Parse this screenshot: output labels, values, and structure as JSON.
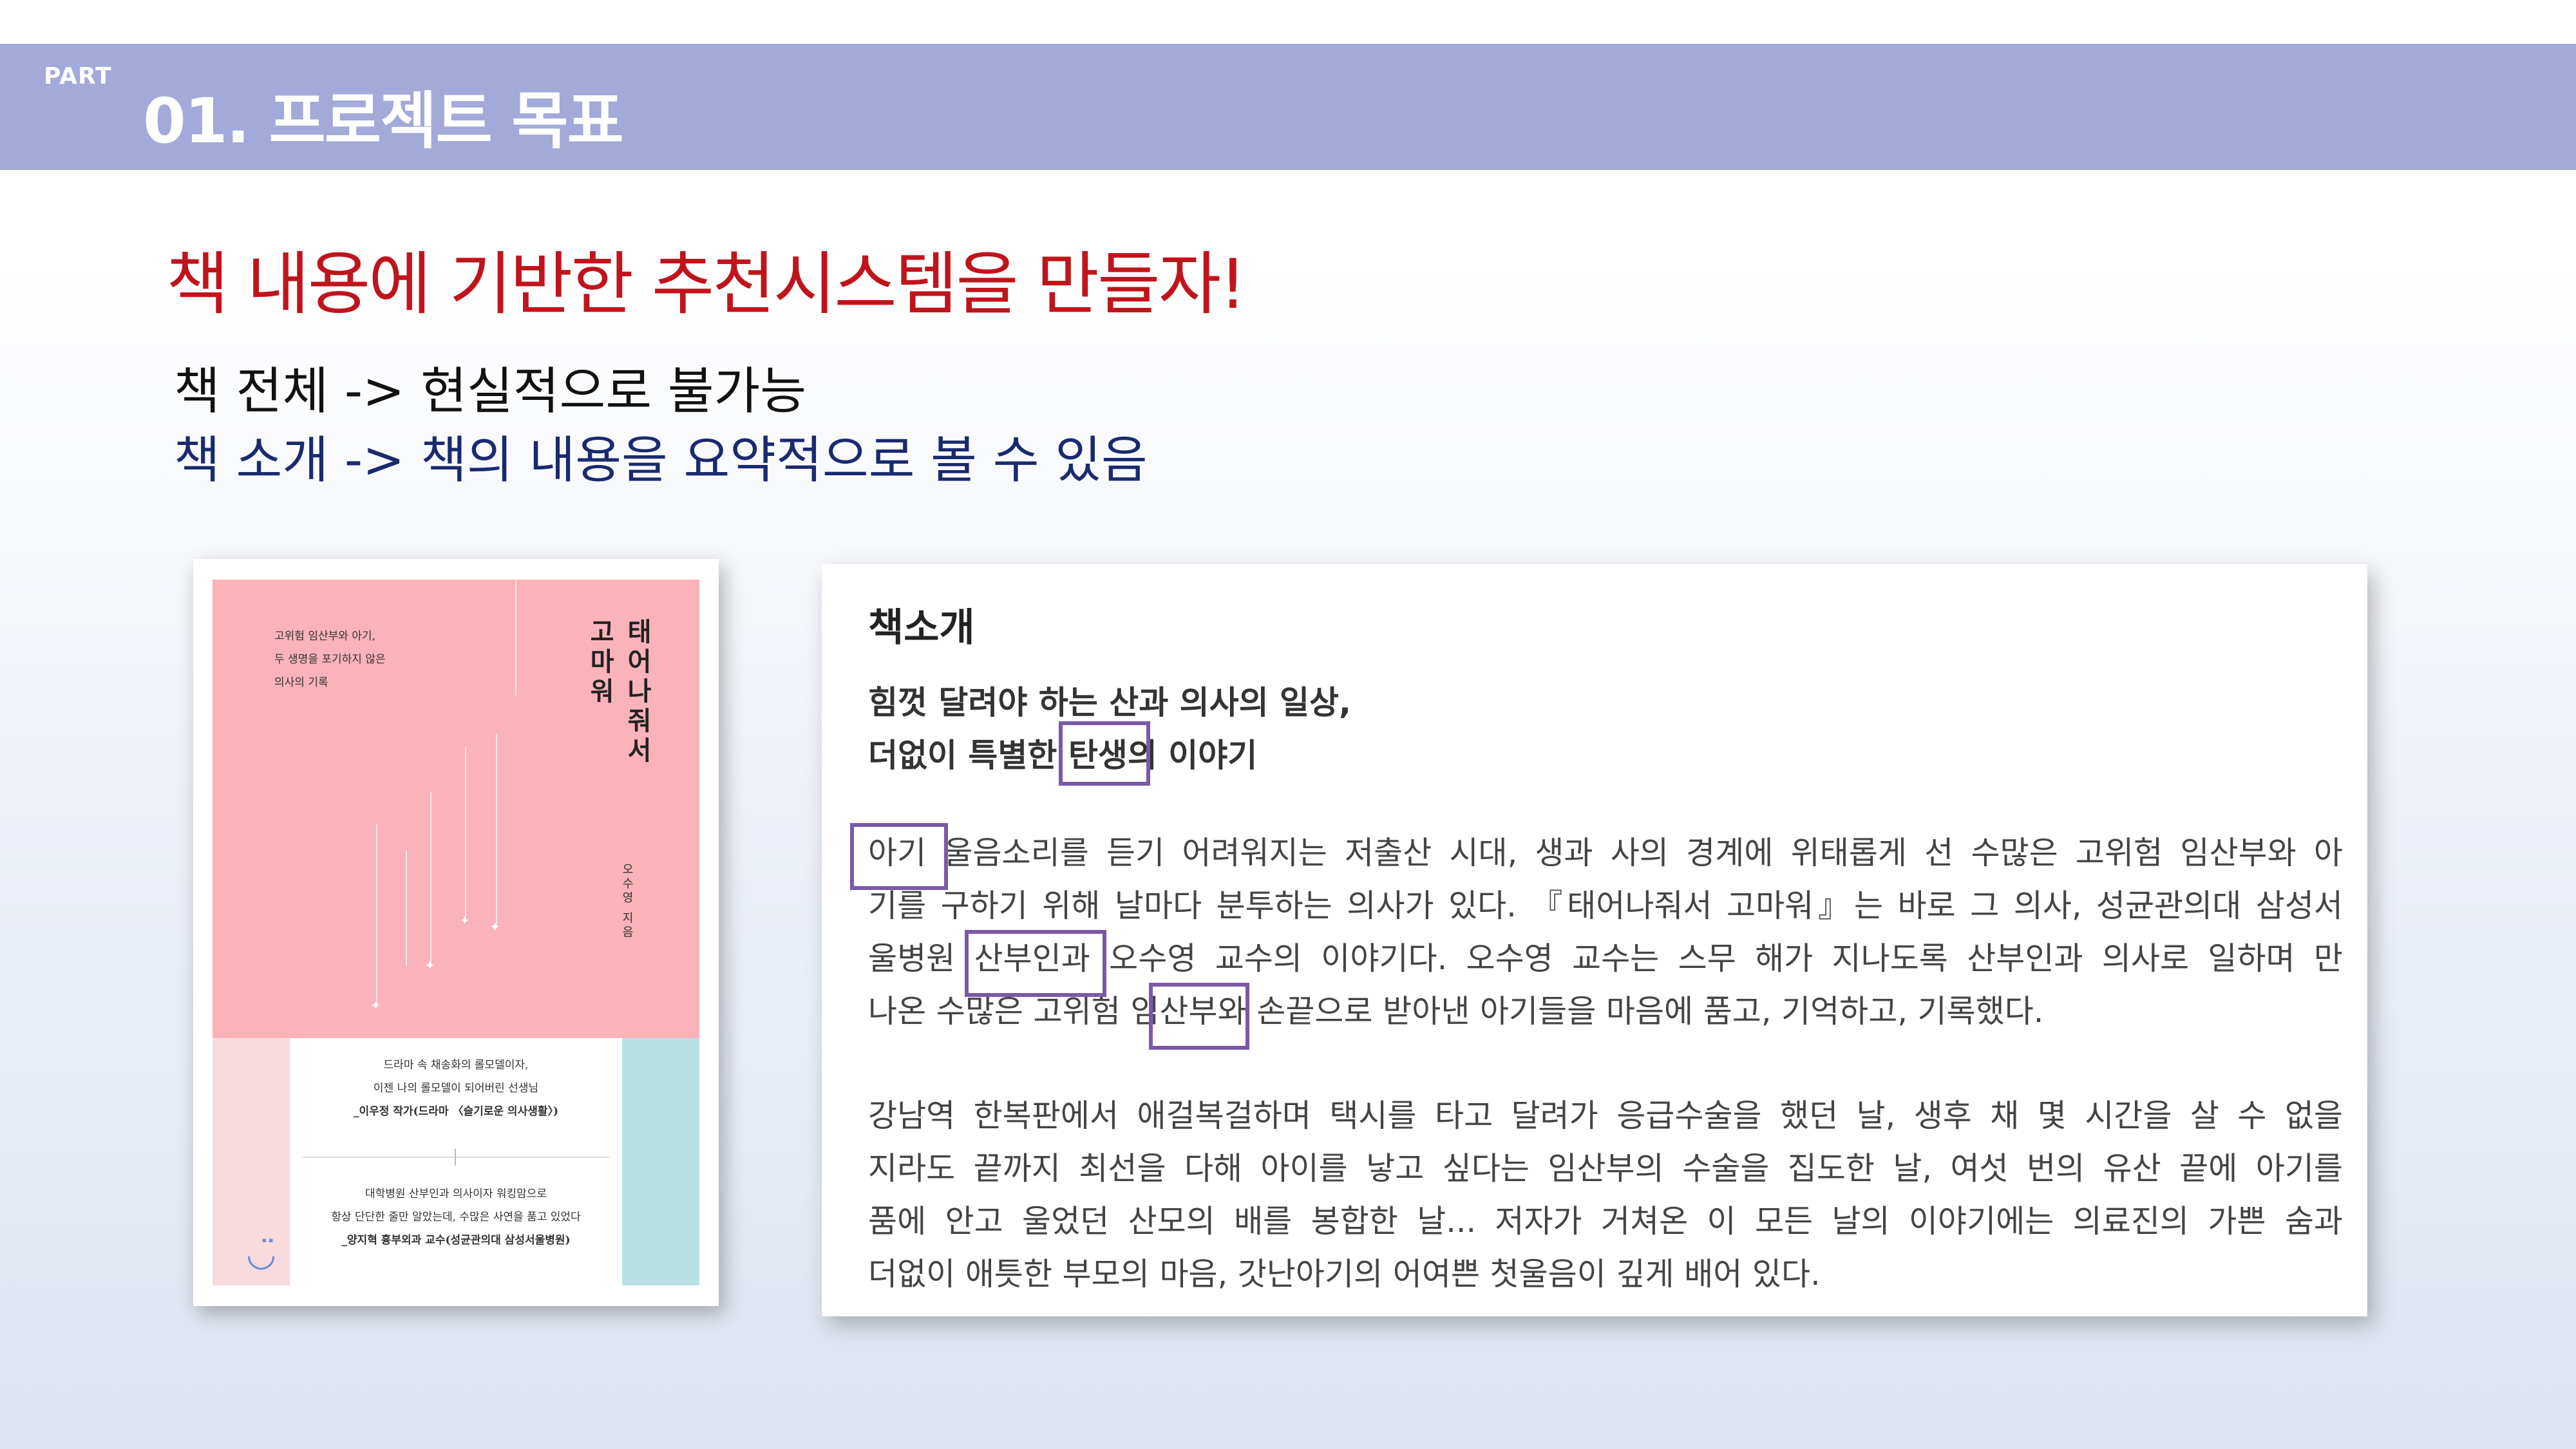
{
  "header": {
    "part_label": "PART",
    "section_title": "01. 프로젝트 목표"
  },
  "headline": "책 내용에 기반한 추천시스템을 만들자!",
  "points": {
    "line1": "책 전체 -> 현실적으로 불가능",
    "line2": "책 소개 -> 책의 내용을 요약적으로 볼 수 있음"
  },
  "book_cover": {
    "title_col1": "태어나줘서",
    "title_col2": "고마워",
    "author": "오수영 지음",
    "blurb": [
      "고위험 임산부와 아기,",
      "두 생명을 포기하지 않은",
      "의사의 기록"
    ],
    "quote1": [
      "드라마 속 채송화의 롤모델이자,",
      "이젠 나의 롤모델이 되어버린 선생님",
      "_이우정 작가(드라마 〈슬기로운 의사생활〉)"
    ],
    "quote2": [
      "대학병원 산부인과 의사이자 워킹맘으로",
      "항상 단단한 줄만 알았는데, 수많은 사연을 품고 있었다",
      "_양지혁 흉부외과 교수(성균관의대 삼성서울병원)"
    ]
  },
  "intro": {
    "heading": "책소개",
    "sub1": "힘껏 달려야 하는 산과 의사의 일상,",
    "sub2": "더없이 특별한 탄생의 이야기",
    "para1": [
      "아기 울음소리를 듣기 어려워지는 저출산 시대, 생과 사의 경계에 위태롭게 선 수많은 고위험 임산부와 아",
      "기를 구하기 위해 날마다 분투하는 의사가 있다. 『태어나줘서 고마워』는 바로 그 의사, 성균관의대 삼성서",
      "울병원 산부인과 오수영 교수의 이야기다. 오수영 교수는 스무 해가 지나도록 산부인과 의사로 일하며 만",
      "나온 수많은 고위험 임산부와 손끝으로 받아낸 아기들을 마음에 품고, 기억하고, 기록했다."
    ],
    "para2": [
      "강남역 한복판에서 애걸복걸하며 택시를 타고 달려가 응급수술을 했던 날, 생후 채 몇 시간을 살 수 없을",
      "지라도 끝까지 최선을 다해 아이를 낳고 싶다는 임산부의 수술을 집도한 날, 여섯 번의 유산 끝에 아기를",
      "품에 안고 울었던 산모의 배를 봉합한 날... 저자가 거쳐온 이 모든 날의 이야기에는 의료진의 가쁜 숨과",
      "더없이 애틋한 부모의 마음, 갓난아기의 어여쁜 첫울음이 깊게 배어 있다."
    ],
    "highlights": [
      "탄생",
      "아기",
      "산부인과",
      "임산부"
    ]
  },
  "colors": {
    "header_band": "#a3a9d8",
    "headline": "#c0141c",
    "line2": "#1a2a6e",
    "highlight_box": "#7a5aa6",
    "cover_pink": "#f9b3b9",
    "cover_teal": "#b8e0e4"
  }
}
